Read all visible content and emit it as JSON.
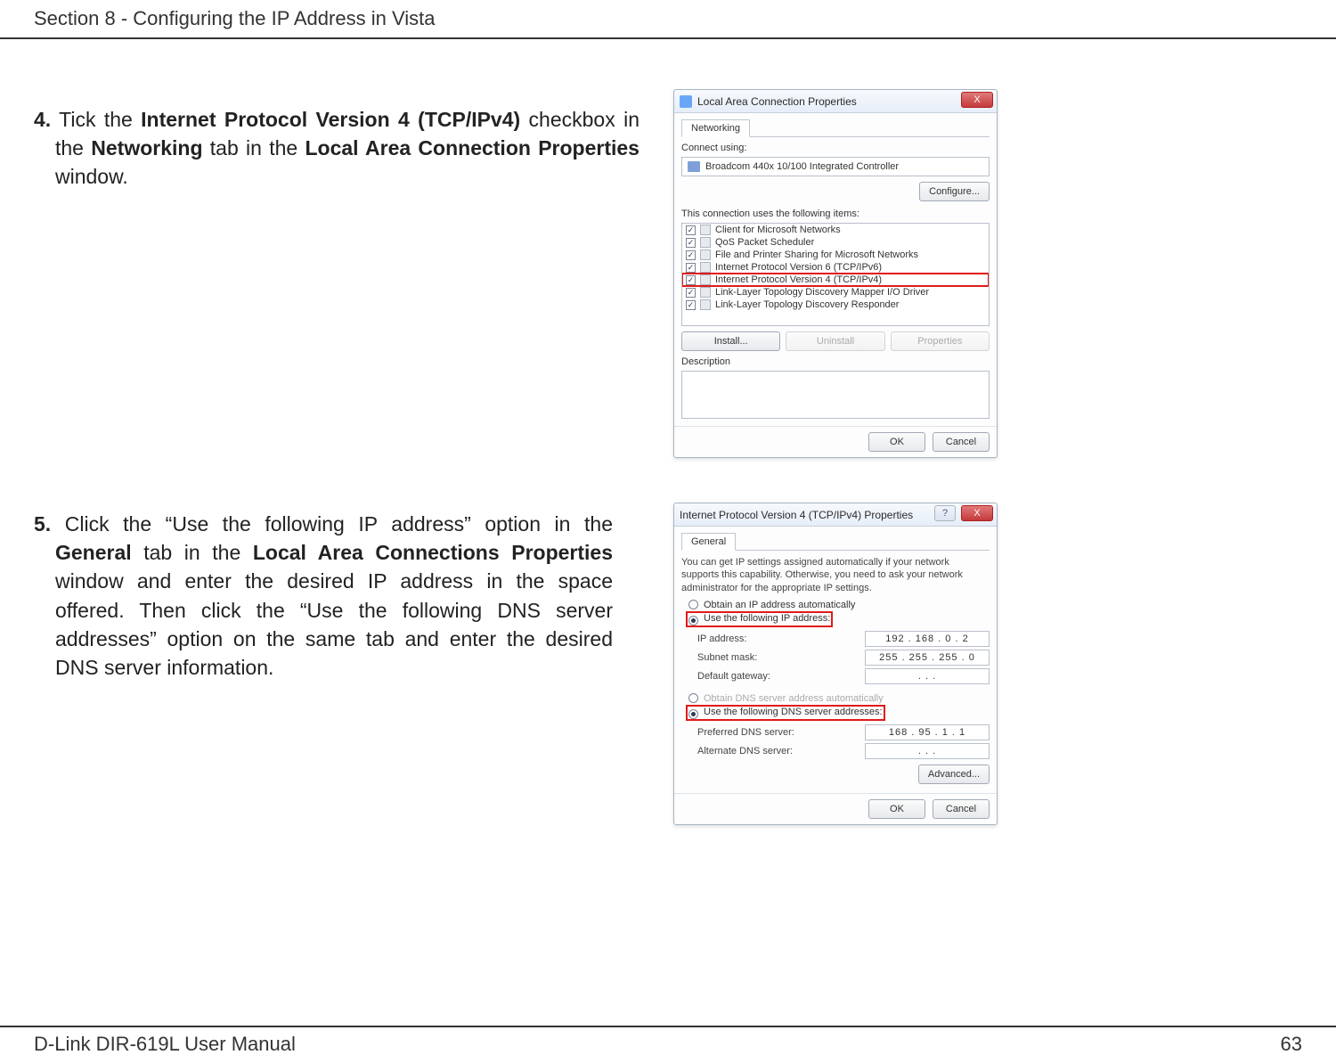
{
  "header": {
    "text": "Section 8 - Configuring the IP Address in Vista"
  },
  "step4": {
    "num": "4.",
    "pre": " Tick the ",
    "b1": "Internet Protocol Version 4 (TCP/IPv4)",
    "mid": " checkbox in the ",
    "b2": "Networking",
    "mid2": " tab in the ",
    "b3": "Local Area Connection Properties",
    "post": " window."
  },
  "step5": {
    "num": "5.",
    "pre": " Click the “Use the following IP address” option in the ",
    "b1": "General",
    "mid": " tab in the ",
    "b2": "Local Area Connections Properties",
    "mid2": " window and enter the desired IP address in the space offered. Then click the “Use the following DNS server addresses” option on the same tab and enter the desired DNS server information."
  },
  "dialog1": {
    "title": "Local Area Connection Properties",
    "tab": "Networking",
    "connect_using": "Connect using:",
    "adapter": "Broadcom 440x 10/100 Integrated Controller",
    "configure": "Configure...",
    "uses_label": "This connection uses the following items:",
    "items": [
      {
        "label": "Client for Microsoft Networks",
        "highlight": false
      },
      {
        "label": "QoS Packet Scheduler",
        "highlight": false
      },
      {
        "label": "File and Printer Sharing for Microsoft Networks",
        "highlight": false
      },
      {
        "label": "Internet Protocol Version 6 (TCP/IPv6)",
        "highlight": false
      },
      {
        "label": "Internet Protocol Version 4 (TCP/IPv4)",
        "highlight": true
      },
      {
        "label": "Link-Layer Topology Discovery Mapper I/O Driver",
        "highlight": false
      },
      {
        "label": "Link-Layer Topology Discovery Responder",
        "highlight": false
      }
    ],
    "install": "Install...",
    "uninstall": "Uninstall",
    "properties": "Properties",
    "description": "Description",
    "ok": "OK",
    "cancel": "Cancel",
    "close_x": "X"
  },
  "dialog2": {
    "title": "Internet Protocol Version 4 (TCP/IPv4) Properties",
    "tab": "General",
    "intro": "You can get IP settings assigned automatically if your network supports this capability. Otherwise, you need to ask your network administrator for the appropriate IP settings.",
    "r_auto_ip": "Obtain an IP address automatically",
    "r_use_ip": "Use the following IP address:",
    "ip_label": "IP address:",
    "ip_value": "192 . 168 .  0  .  2",
    "subnet_label": "Subnet mask:",
    "subnet_value": "255 . 255 . 255 .  0",
    "gateway_label": "Default gateway:",
    "gateway_value": ".     .     .",
    "r_auto_dns": "Obtain DNS server address automatically",
    "r_use_dns": "Use the following DNS server addresses:",
    "pref_dns_label": "Preferred DNS server:",
    "pref_dns_value": "168 .  95  .  1  .  1",
    "alt_dns_label": "Alternate DNS server:",
    "alt_dns_value": ".     .     .",
    "advanced": "Advanced...",
    "ok": "OK",
    "cancel": "Cancel",
    "help": "?",
    "close_x": "X"
  },
  "footer": {
    "left": "D-Link DIR-619L User Manual",
    "right": "63"
  }
}
